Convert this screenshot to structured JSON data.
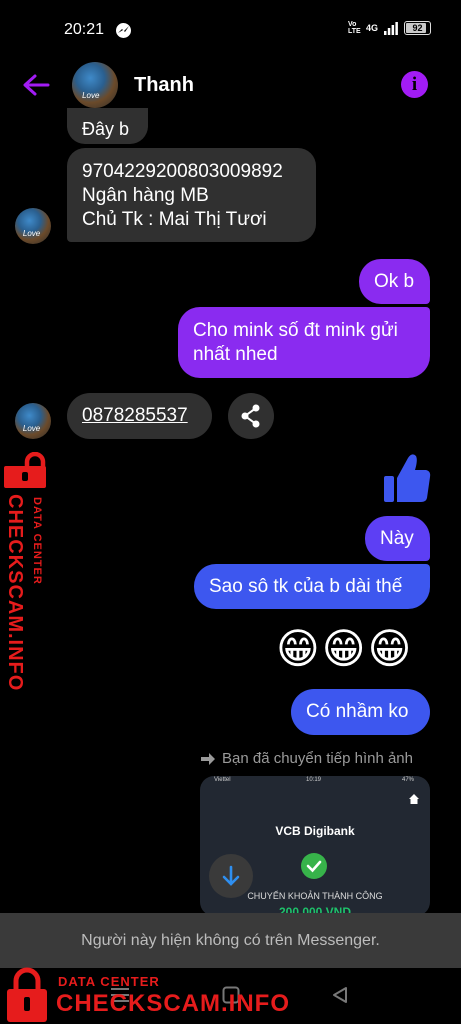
{
  "status_bar": {
    "time": "20:21",
    "network": "4G",
    "volte": "Vo LTE",
    "battery_level": 0.92,
    "battery_text": "92"
  },
  "header": {
    "contact_name": "Thanh",
    "avatar_caption": "Love"
  },
  "messages": {
    "partial_top": "Đây b",
    "account_number": "9704229200803009892",
    "bank_name": "Ngân hàng MB",
    "account_holder": "Chủ Tk : Mai Thị Tươi",
    "ok": "Ok b",
    "ask_phone": "Cho mink số đt mink gửi nhất nhed",
    "phone_number": "0878285537",
    "nay": "Này",
    "sao_so_tk": "Sao sô tk của b dài thế",
    "emoji": "😁😁😁",
    "co_nham": "Có nhầm ko",
    "forwarded_note": "Bạn đã chuyển tiếp hình ảnh"
  },
  "forwarded_image": {
    "carrier": "Viettel",
    "time": "10:19",
    "battery": "47%",
    "app_title": "VCB Digibank",
    "status": "CHUYỂN KHOẢN THÀNH CÔNG",
    "amount": "200,000 VND"
  },
  "footer": {
    "unavailable_text": "Người này hiện không có trên Messenger."
  },
  "watermark": {
    "small": "DATA CENTER",
    "big": "CHECKSCAM.INFO"
  },
  "colors": {
    "accent_purple": "#a21cf5",
    "bubble_incoming": "#303030",
    "bubble_purple": "#8a2bf0",
    "bubble_violet": "#5d3ff4",
    "bubble_blue": "#3d57ef",
    "watermark_red": "#e61c1c"
  }
}
